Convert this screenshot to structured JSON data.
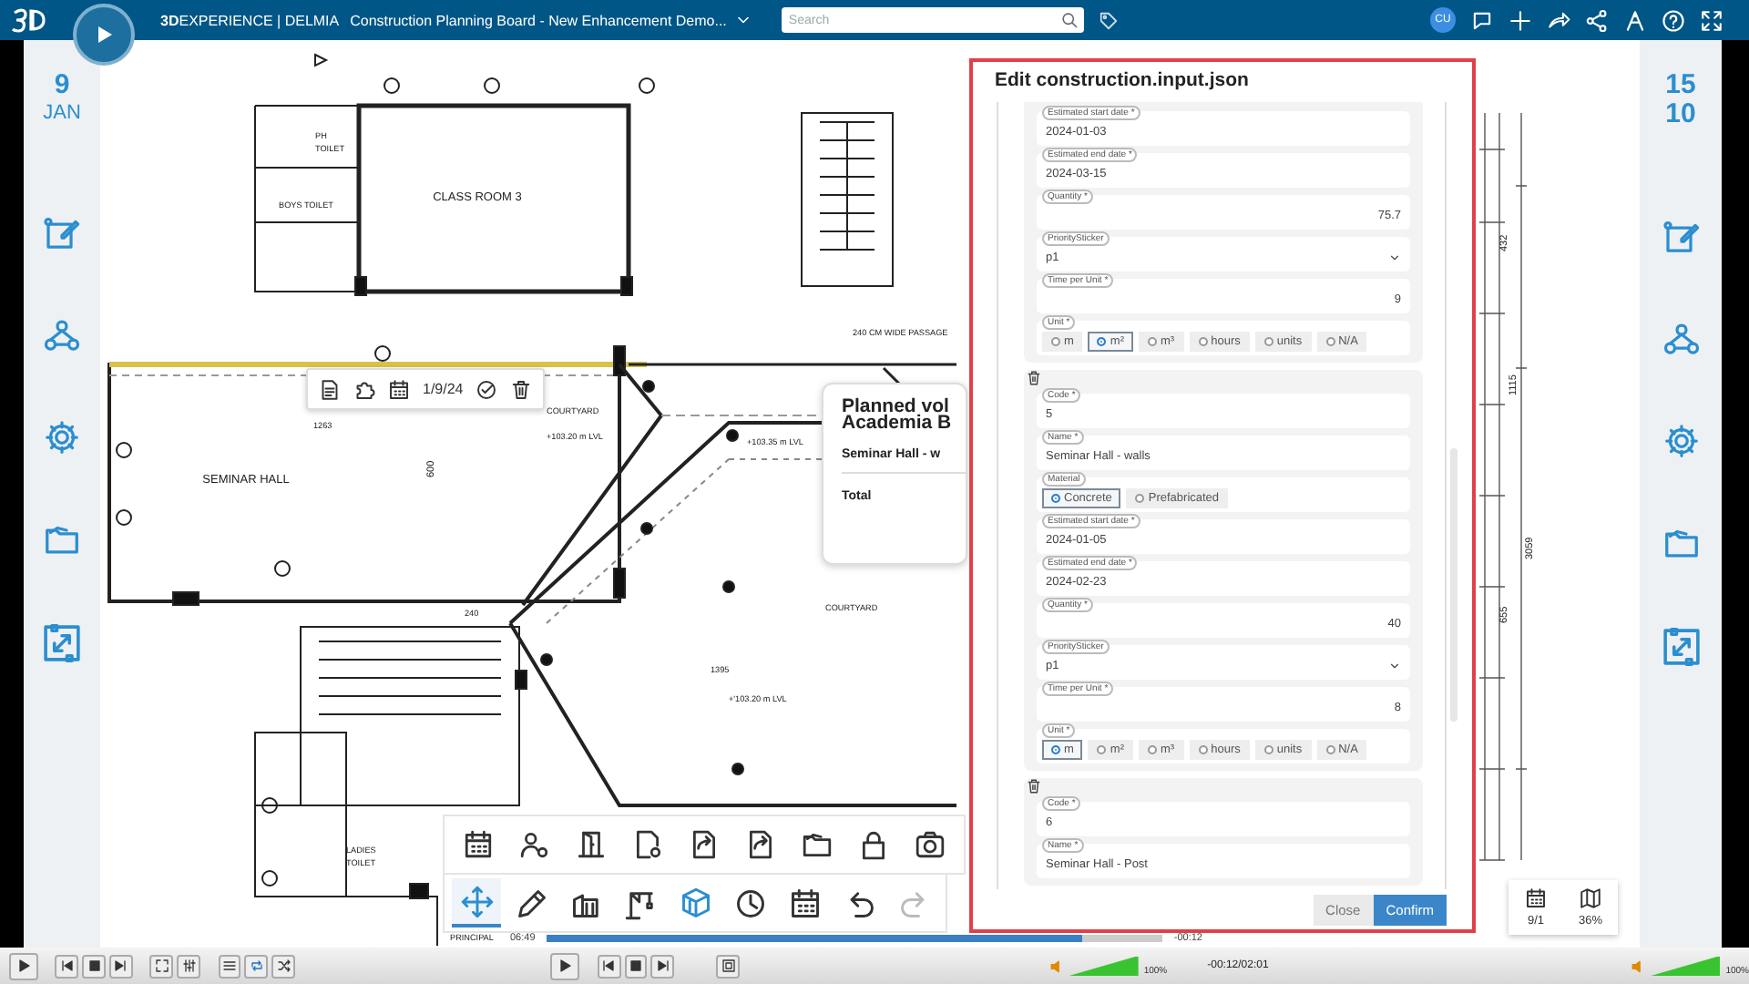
{
  "top_bar": {
    "brand": "**3D**EXPERIENCE | DELMIA",
    "title": "Construction Planning Board - New Enhancement Demo...",
    "search": {
      "placeholder": "Search"
    },
    "avatar": "CU"
  },
  "left_rail": {
    "day": "9",
    "month": "JAN"
  },
  "right_rail": {
    "day": "15",
    "month": "10"
  },
  "floor_plan": {
    "labels": [
      {
        "text": "CLASS ROOM 3",
        "kind": "room"
      },
      {
        "text": "SEMINAR HALL",
        "kind": "room"
      },
      {
        "text": "COURTYARD",
        "kind": "note"
      },
      {
        "text": "+103.20 m LVL",
        "kind": "note"
      },
      {
        "text": "+103.35 m LVL",
        "kind": "note"
      },
      {
        "text": "COURTYARD",
        "kind": "note"
      },
      {
        "text": "+'103.20 m LVL",
        "kind": "note"
      },
      {
        "text": "1395",
        "kind": "note"
      },
      {
        "text": "240 CM WIDE PASSAGE",
        "kind": "note"
      },
      {
        "text": "PH",
        "kind": "note"
      },
      {
        "text": "TOILET",
        "kind": "note"
      },
      {
        "text": "BOYS TOILET",
        "kind": "note"
      },
      {
        "text": "LADIES",
        "kind": "note"
      },
      {
        "text": "TOILET",
        "kind": "note"
      },
      {
        "text": "240",
        "kind": "note"
      },
      {
        "text": "1263",
        "kind": "note"
      },
      {
        "text": "600",
        "kind": "vertical"
      },
      {
        "text": "432",
        "kind": "vertical"
      },
      {
        "text": "1115",
        "kind": "vertical"
      },
      {
        "text": "3059",
        "kind": "vertical"
      },
      {
        "text": "655",
        "kind": "vertical"
      },
      {
        "text": "PRINCIPAL",
        "kind": "note"
      }
    ]
  },
  "selection_toolbar": {
    "date": "1/9/24"
  },
  "volume_popup": {
    "title_lines": [
      "Planned vol",
      "Academia B"
    ],
    "rows": [
      "Seminar Hall - w",
      "Total"
    ]
  },
  "dialog": {
    "title": "Edit construction.input.json",
    "sections": [
      {
        "has_delete": false,
        "fields": [
          {
            "kind": "text",
            "label": "Estimated start date *",
            "value": "2024-01-03"
          },
          {
            "kind": "text",
            "label": "Estimated end date *",
            "value": "2024-03-15"
          },
          {
            "kind": "number",
            "label": "Quantity *",
            "value": "75.7"
          },
          {
            "kind": "select",
            "label": "PrioritySticker",
            "value": "p1"
          },
          {
            "kind": "number",
            "label": "Time per Unit *",
            "value": "9"
          },
          {
            "kind": "radio",
            "label": "Unit *",
            "options": [
              {
                "label": "m",
                "selected": false
              },
              {
                "label": "m²",
                "selected": true
              },
              {
                "label": "m³",
                "selected": false
              },
              {
                "label": "hours",
                "selected": false
              },
              {
                "label": "units",
                "selected": false
              },
              {
                "label": "N/A",
                "selected": false
              }
            ]
          }
        ]
      },
      {
        "has_delete": true,
        "fields": [
          {
            "kind": "text",
            "label": "Code *",
            "value": "5"
          },
          {
            "kind": "text",
            "label": "Name *",
            "value": "Seminar Hall - walls"
          },
          {
            "kind": "radio",
            "label": "Material",
            "options": [
              {
                "label": "Concrete",
                "selected": true
              },
              {
                "label": "Prefabricated",
                "selected": false
              }
            ]
          },
          {
            "kind": "text",
            "label": "Estimated start date *",
            "value": "2024-01-05"
          },
          {
            "kind": "text",
            "label": "Estimated end date *",
            "value": "2024-02-23"
          },
          {
            "kind": "number",
            "label": "Quantity *",
            "value": "40"
          },
          {
            "kind": "select",
            "label": "PrioritySticker",
            "value": "p1"
          },
          {
            "kind": "number",
            "label": "Time per Unit *",
            "value": "8"
          },
          {
            "kind": "radio",
            "label": "Unit *",
            "options": [
              {
                "label": "m",
                "selected": true
              },
              {
                "label": "m²",
                "selected": false
              },
              {
                "label": "m³",
                "selected": false
              },
              {
                "label": "hours",
                "selected": false
              },
              {
                "label": "units",
                "selected": false
              },
              {
                "label": "N/A",
                "selected": false
              }
            ]
          }
        ]
      },
      {
        "has_delete": true,
        "fields": [
          {
            "kind": "text",
            "label": "Code *",
            "value": "6"
          },
          {
            "kind": "text",
            "label": "Name *",
            "value": "Seminar Hall - Post"
          }
        ]
      }
    ],
    "buttons": [
      {
        "label": "Close",
        "kind": "secondary"
      },
      {
        "label": "Confirm",
        "kind": "primary"
      }
    ]
  },
  "tool_palette": [
    {
      "selected": true,
      "disabled": false
    },
    {
      "selected": false,
      "disabled": false
    },
    {
      "selected": false,
      "disabled": false
    },
    {
      "selected": false,
      "disabled": false
    },
    {
      "selected": false,
      "disabled": false
    },
    {
      "selected": false,
      "disabled": false
    },
    {
      "selected": false,
      "disabled": false
    },
    {
      "selected": false,
      "disabled": false
    },
    {
      "selected": false,
      "disabled": true
    }
  ],
  "view_buttons": [
    {
      "label": "9/1"
    },
    {
      "label": "36%"
    }
  ],
  "video": {
    "elapsed": "06:49",
    "remaining": "-00:12",
    "level": 0.87
  },
  "player": {
    "time": "-00:12/02:01",
    "volumes": [
      {
        "reading": "100%",
        "level": 1
      },
      {
        "reading": "100%",
        "level": 1
      }
    ]
  }
}
